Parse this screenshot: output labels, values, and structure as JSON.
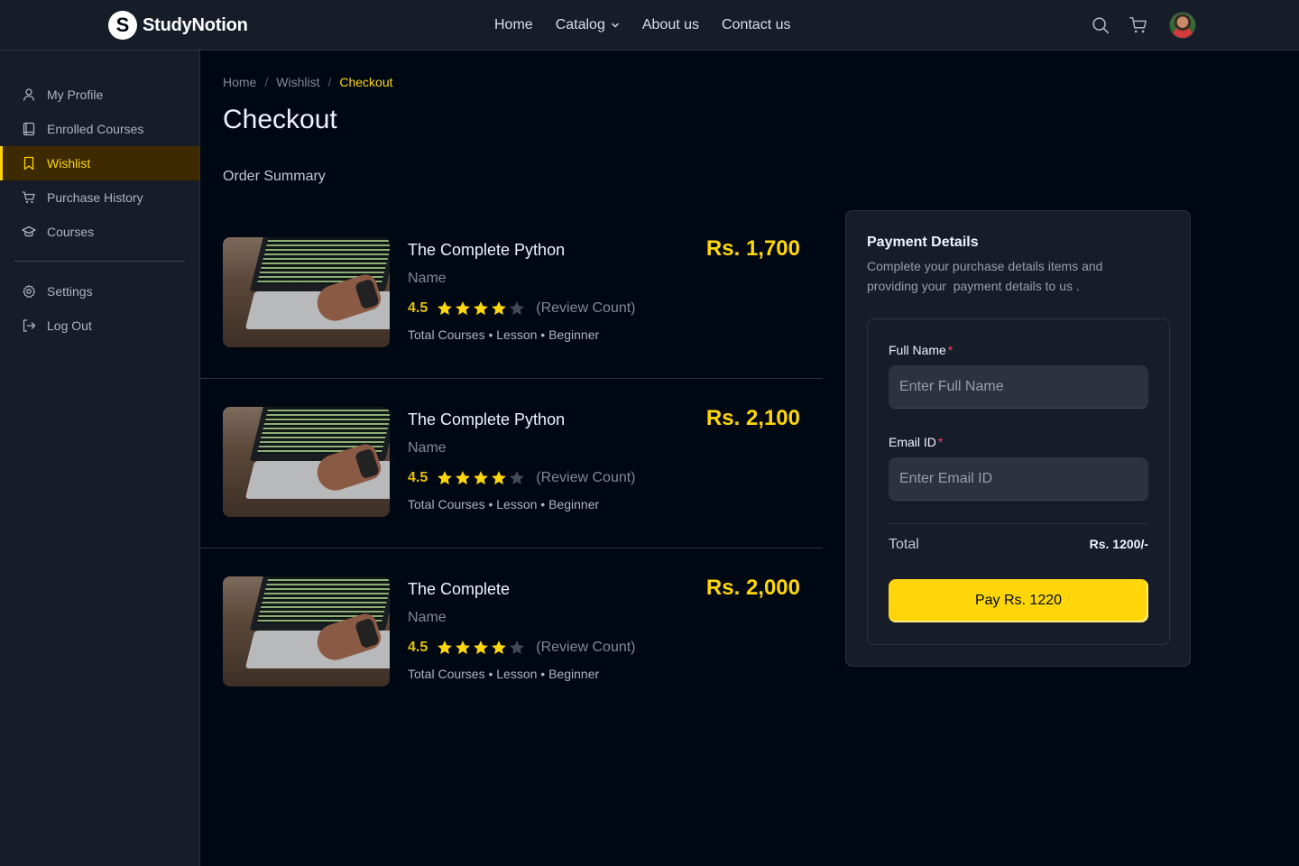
{
  "header": {
    "brand": "StudyNotion",
    "logo_letter": "S",
    "nav": [
      {
        "label": "Home"
      },
      {
        "label": "Catalog"
      },
      {
        "label": "About us"
      },
      {
        "label": "Contact us"
      }
    ],
    "icons": [
      "search-icon",
      "cart-icon",
      "avatar"
    ]
  },
  "sidebar": {
    "items": [
      {
        "label": "My Profile",
        "icon": "user-icon"
      },
      {
        "label": "Enrolled Courses",
        "icon": "book-icon"
      },
      {
        "label": "Wishlist",
        "icon": "bookmark-icon",
        "active": true
      },
      {
        "label": "Purchase History",
        "icon": "cart-icon"
      },
      {
        "label": "Courses",
        "icon": "graduation-cap-icon"
      }
    ],
    "bottom_items": [
      {
        "label": "Settings",
        "icon": "gear-icon"
      },
      {
        "label": "Log Out",
        "icon": "logout-icon"
      }
    ]
  },
  "breadcrumb": {
    "items": [
      "Home",
      "Wishlist",
      "Checkout"
    ],
    "separator": "/"
  },
  "page": {
    "title": "Checkout",
    "section_title": "Order Summary"
  },
  "courses": [
    {
      "title": "The Complete Python",
      "subtitle": "Name",
      "rating": "4.5",
      "stars_filled": 4,
      "stars_total": 5,
      "review_count": "(Review Count)",
      "meta": "Total Courses • Lesson • Beginner",
      "price": "Rs. 1,700"
    },
    {
      "title": "The Complete Python",
      "subtitle": "Name",
      "rating": "4.5",
      "stars_filled": 4,
      "stars_total": 5,
      "review_count": "(Review Count)",
      "meta": "Total Courses • Lesson • Beginner",
      "price": "Rs. 2,100"
    },
    {
      "title": "The Complete",
      "subtitle": "Name",
      "rating": "4.5",
      "stars_filled": 4,
      "stars_total": 5,
      "review_count": "(Review Count)",
      "meta": "Total Courses • Lesson • Beginner",
      "price": "Rs. 2,000"
    }
  ],
  "payment": {
    "title": "Payment Details",
    "description": "Complete your purchase details items and providing your  payment details to us .",
    "full_name": {
      "label": "Full Name",
      "required_mark": "*",
      "placeholder": "Enter Full Name",
      "value": ""
    },
    "email": {
      "label": "Email ID",
      "required_mark": "*",
      "placeholder": "Enter Email ID",
      "value": ""
    },
    "total_label": "Total",
    "total_value": "Rs. 1200/-",
    "button_label": "Pay Rs. 1220"
  },
  "colors": {
    "accent": "#FFD60A",
    "background": "#000814",
    "panel": "#161D29",
    "active_bg": "#3D2A01"
  }
}
